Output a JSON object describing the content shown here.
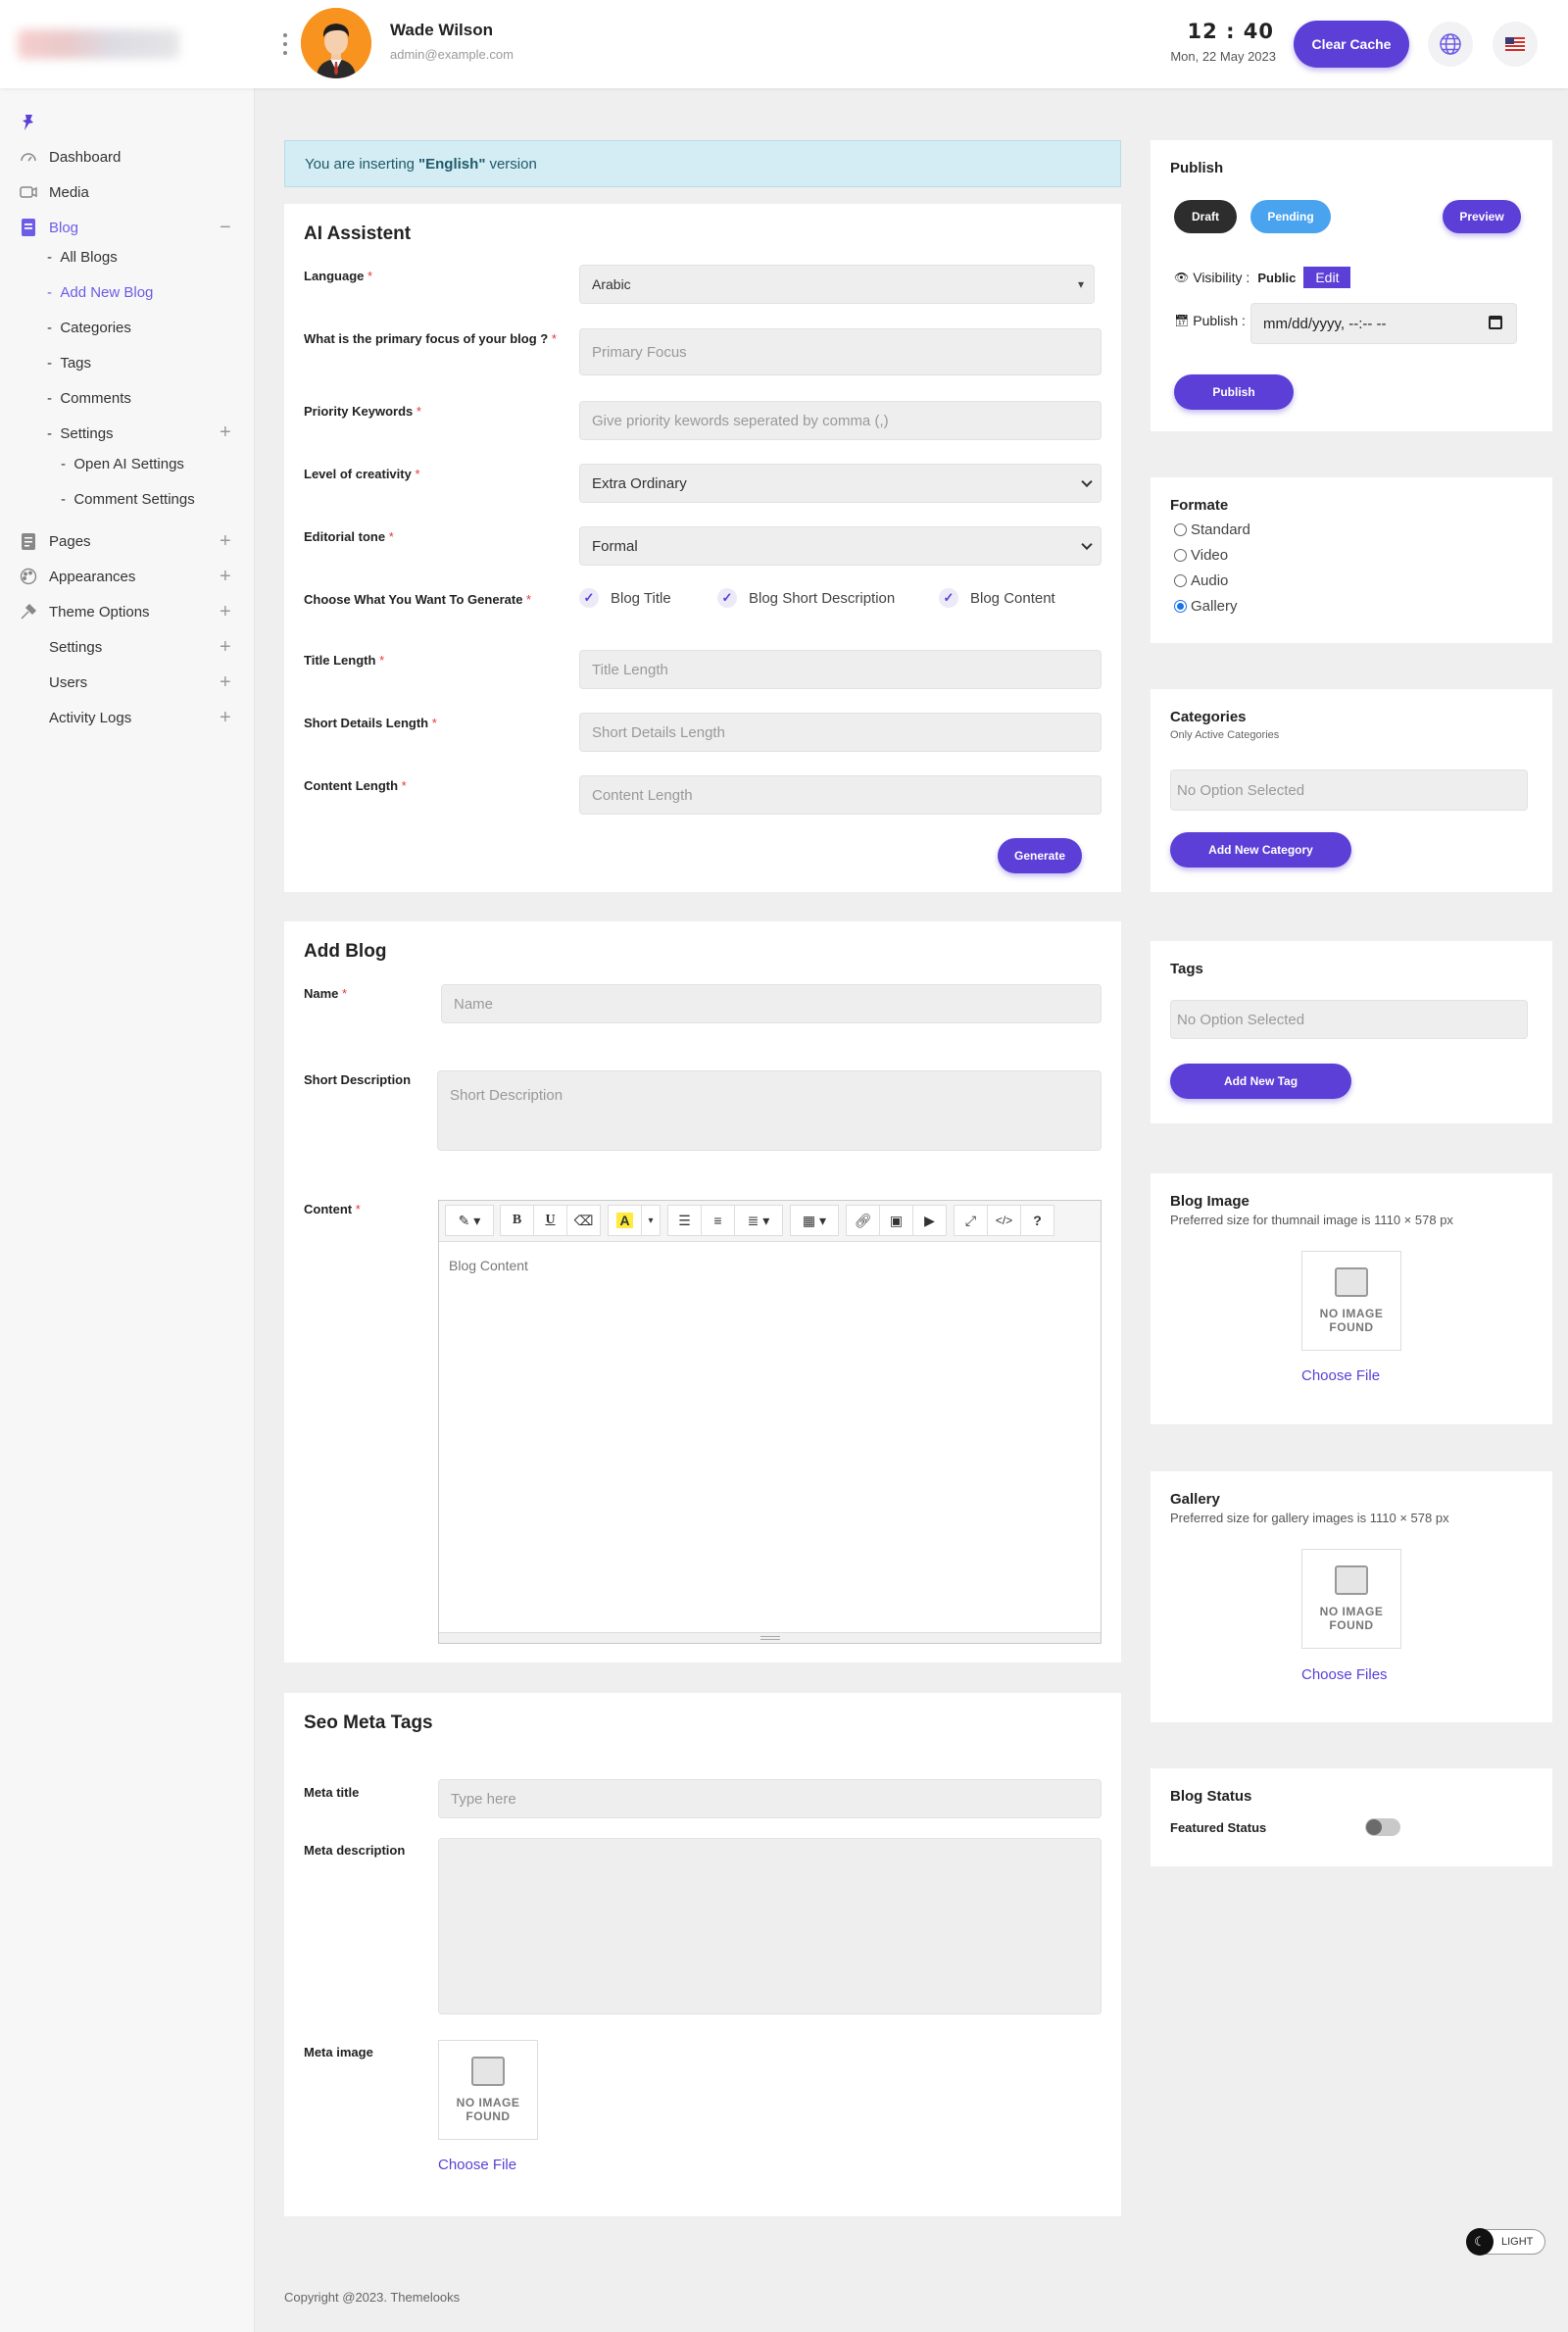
{
  "header": {
    "user_name": "Wade Wilson",
    "user_email": "admin@example.com",
    "time": "12 : 40",
    "date": "Mon, 22 May 2023",
    "clear_cache": "Clear Cache"
  },
  "sidebar": {
    "items": [
      {
        "label": "Dashboard",
        "icon": "dashboard-icon"
      },
      {
        "label": "Media",
        "icon": "media-icon"
      },
      {
        "label": "Blog",
        "icon": "blog-icon",
        "toggle": "−"
      },
      {
        "label": "Pages",
        "icon": "pages-icon",
        "toggle": "+"
      },
      {
        "label": "Appearances",
        "icon": "appearances-icon",
        "toggle": "+"
      },
      {
        "label": "Theme Options",
        "icon": "theme-options-icon",
        "toggle": "+"
      },
      {
        "label": "Settings",
        "toggle": "+"
      },
      {
        "label": "Users",
        "toggle": "+"
      },
      {
        "label": "Activity Logs",
        "toggle": "+"
      }
    ],
    "blog_sub": [
      "All Blogs",
      "Add New Blog",
      "Categories",
      "Tags",
      "Comments",
      "Settings"
    ],
    "settings_toggle": "+",
    "settings_sub": [
      "Open AI Settings",
      "Comment Settings"
    ]
  },
  "notice": {
    "prefix": "You are inserting ",
    "lang": "\"English\"",
    "suffix": " version"
  },
  "ai": {
    "title": "AI Assistent",
    "language_label": "Language",
    "language_value": "Arabic",
    "focus_label": "What is the primary focus of your blog ?",
    "focus_placeholder": "Primary Focus",
    "keywords_label": "Priority Keywords",
    "keywords_placeholder": "Give priority kewords seperated by comma (,)",
    "creativity_label": "Level of creativity",
    "creativity_value": "Extra Ordinary",
    "tone_label": "Editorial tone",
    "tone_value": "Formal",
    "generate_label": "Choose What You Want To Generate",
    "options": [
      "Blog Title",
      "Blog Short Description",
      "Blog Content"
    ],
    "title_length_label": "Title Length",
    "title_length_placeholder": "Title Length",
    "short_length_label": "Short Details Length",
    "short_length_placeholder": "Short Details Length",
    "content_length_label": "Content Length",
    "content_length_placeholder": "Content Length",
    "generate_button": "Generate",
    "required_mark": "*"
  },
  "add_blog": {
    "title": "Add Blog",
    "name_label": "Name",
    "name_placeholder": "Name",
    "short_label": "Short Description",
    "short_placeholder": "Short Description",
    "content_label": "Content",
    "content_placeholder": "Blog Content",
    "toolbar_text": {
      "bold": "B",
      "underline": "U",
      "help": "?",
      "code": "</>"
    }
  },
  "seo": {
    "title": "Seo Meta Tags",
    "meta_title_label": "Meta title",
    "meta_title_placeholder": "Type here",
    "meta_desc_label": "Meta description",
    "meta_image_label": "Meta image",
    "choose_file": "Choose File"
  },
  "no_image": {
    "line1": "NO IMAGE",
    "line2": "FOUND"
  },
  "publish": {
    "title": "Publish",
    "draft": "Draft",
    "pending": "Pending",
    "preview": "Preview",
    "visibility_label": "Visibility :",
    "visibility_value": "Public",
    "edit": "Edit",
    "publish_label": "Publish :",
    "date_placeholder": "mm/dd/yyyy, --:-- --",
    "publish_button": "Publish"
  },
  "formate": {
    "title": "Formate",
    "options": [
      "Standard",
      "Video",
      "Audio",
      "Gallery"
    ],
    "selected": "Gallery"
  },
  "categories": {
    "title": "Categories",
    "subtitle": "Only Active Categories",
    "placeholder": "No Option Selected",
    "button": "Add New Category"
  },
  "tags": {
    "title": "Tags",
    "placeholder": "No Option Selected",
    "button": "Add New Tag"
  },
  "blog_image": {
    "title": "Blog Image",
    "subtitle": "Preferred size for thumnail image is 1110 × 578 px",
    "choose": "Choose File"
  },
  "gallery": {
    "title": "Gallery",
    "subtitle": "Preferred size for gallery images is 1110 × 578 px",
    "choose": "Choose Files"
  },
  "blog_status": {
    "title": "Blog Status",
    "featured_label": "Featured Status",
    "featured_on": false
  },
  "theme_toggle": "LIGHT",
  "footer": "Copyright @2023. Themelooks",
  "colors": {
    "accent": "#5b3fd6",
    "pending": "#4aa3ef",
    "draft": "#2d2d2d",
    "notice_bg": "#d4ecf3"
  }
}
